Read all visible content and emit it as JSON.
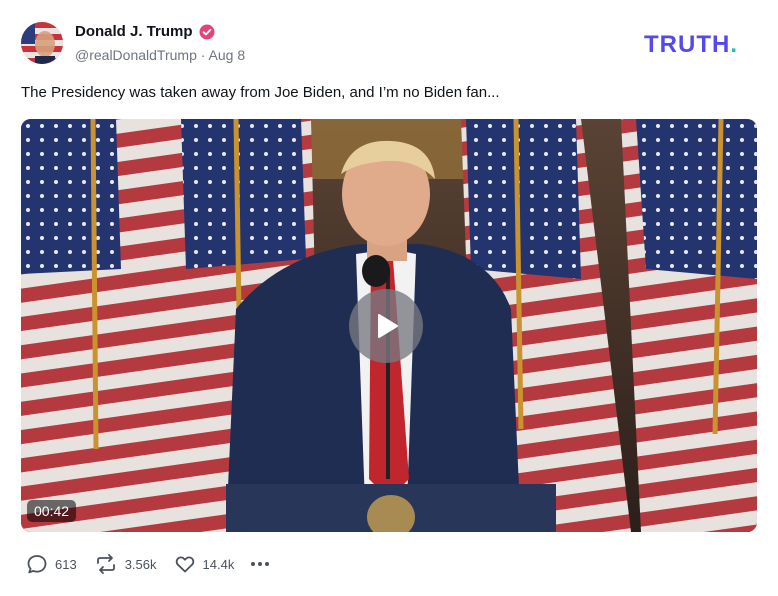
{
  "post": {
    "author": {
      "display_name": "Donald J. Trump",
      "handle": "@realDonaldTrump",
      "separator": " · ",
      "date": "Aug 8",
      "verified_color": "#e0467a"
    },
    "text": "The Presidency was taken away from Joe Biden, and I’m no Biden fan...",
    "media": {
      "type": "video",
      "duration": "00:42"
    },
    "stats": {
      "replies": "613",
      "retruths": "3.56k",
      "likes": "14.4k"
    }
  },
  "brand": {
    "logo_text": "TRUTH.",
    "primary_color": "#5448ee",
    "accent_color": "#16c8a8"
  },
  "icons": [
    "verified-badge-icon",
    "reply-icon",
    "retruth-icon",
    "like-icon",
    "more-icon",
    "play-icon"
  ]
}
